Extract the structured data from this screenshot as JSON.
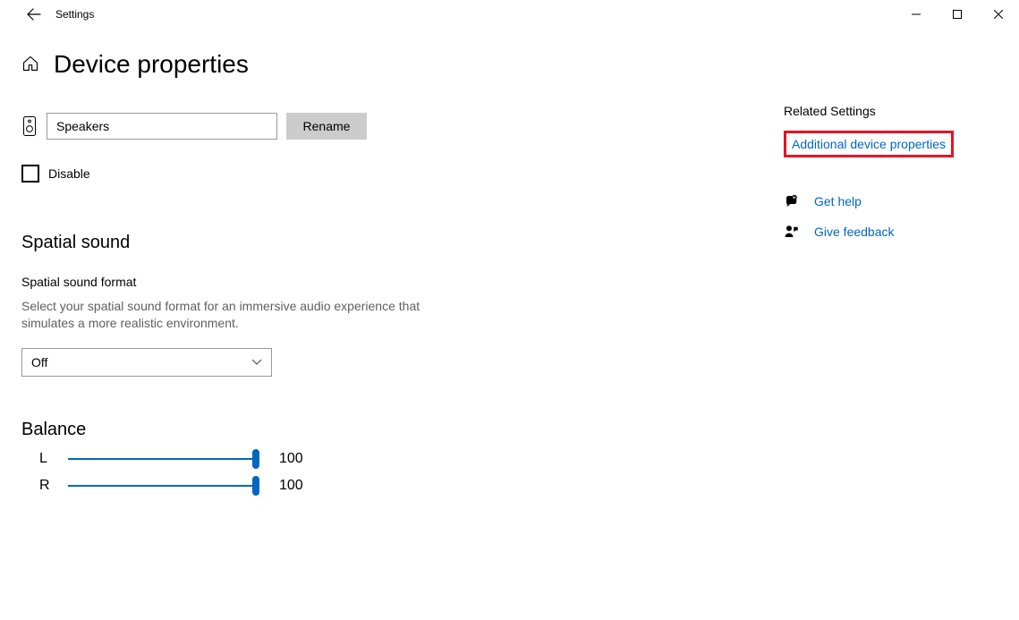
{
  "window": {
    "app_title": "Settings"
  },
  "page": {
    "title": "Device properties"
  },
  "device": {
    "name_value": "Speakers",
    "rename_label": "Rename",
    "disable_label": "Disable"
  },
  "spatial": {
    "section_title": "Spatial sound",
    "format_label": "Spatial sound format",
    "description": "Select your spatial sound format for an immersive audio experience that simulates a more realistic environment.",
    "selected": "Off"
  },
  "balance": {
    "section_title": "Balance",
    "left_label": "L",
    "left_value": "100",
    "right_label": "R",
    "right_value": "100"
  },
  "side": {
    "related_heading": "Related Settings",
    "additional_link": "Additional device properties",
    "help_link": "Get help",
    "feedback_link": "Give feedback"
  }
}
